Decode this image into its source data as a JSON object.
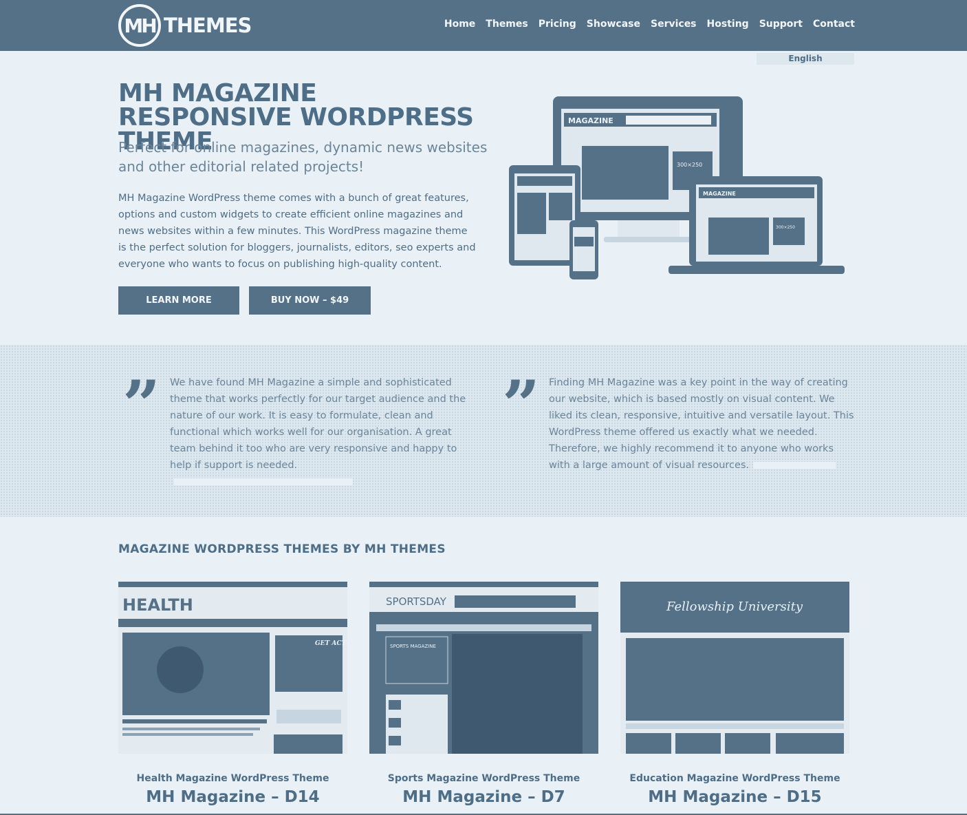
{
  "logo": {
    "mark": "MH",
    "text": "THEMES"
  },
  "nav": [
    "Home",
    "Themes",
    "Pricing",
    "Showcase",
    "Services",
    "Hosting",
    "Support",
    "Contact"
  ],
  "language": "English",
  "hero": {
    "title": "MH MAGAZINE RESPONSIVE WORDPRESS THEME",
    "subtitle": "Perfect for online magazines, dynamic news websites and other editorial related projects!",
    "body": "MH Magazine WordPress theme comes with a bunch of great features, options and custom widgets to create efficient online magazines and news websites within a few minutes. This WordPress magazine theme is the perfect solution for bloggers, journalists, editors, seo experts and everyone who wants to focus on publishing high-quality content.",
    "learn_more": "LEARN MORE",
    "buy_now": "BUY NOW – $49",
    "mockup": {
      "brand": "MAGAZINE",
      "ad": "300×250"
    }
  },
  "testimonials": [
    {
      "text": "We have found MH Magazine a simple and sophisticated theme that works perfectly for our target audience and the nature of our work. It is easy to formulate, clean and functional which works well for our organisation. A great team behind it too who are very responsive and happy to help if support is needed."
    },
    {
      "text": "Finding MH Magazine was a key point in the way of creating our website, which is based mostly on visual content. We liked its clean, responsive, intuitive and versatile layout. This WordPress theme offered us exactly what we needed. Therefore, we highly recommend it to anyone who works with a large amount of visual resources."
    }
  ],
  "themes_section": {
    "title": "MAGAZINE WORDPRESS THEMES BY MH THEMES",
    "cards": [
      {
        "subtitle": "Health Magazine WordPress Theme",
        "title": "MH Magazine – D14",
        "brand": "HEALTH",
        "promo": "GET ACTIVE"
      },
      {
        "subtitle": "Sports Magazine WordPress Theme",
        "title": "MH Magazine – D7",
        "brand": "SPORTSDAY",
        "box": "SPORTS MAGAZINE"
      },
      {
        "subtitle": "Education Magazine WordPress Theme",
        "title": "MH Magazine – D15",
        "brand": "Fellowship University"
      }
    ]
  }
}
